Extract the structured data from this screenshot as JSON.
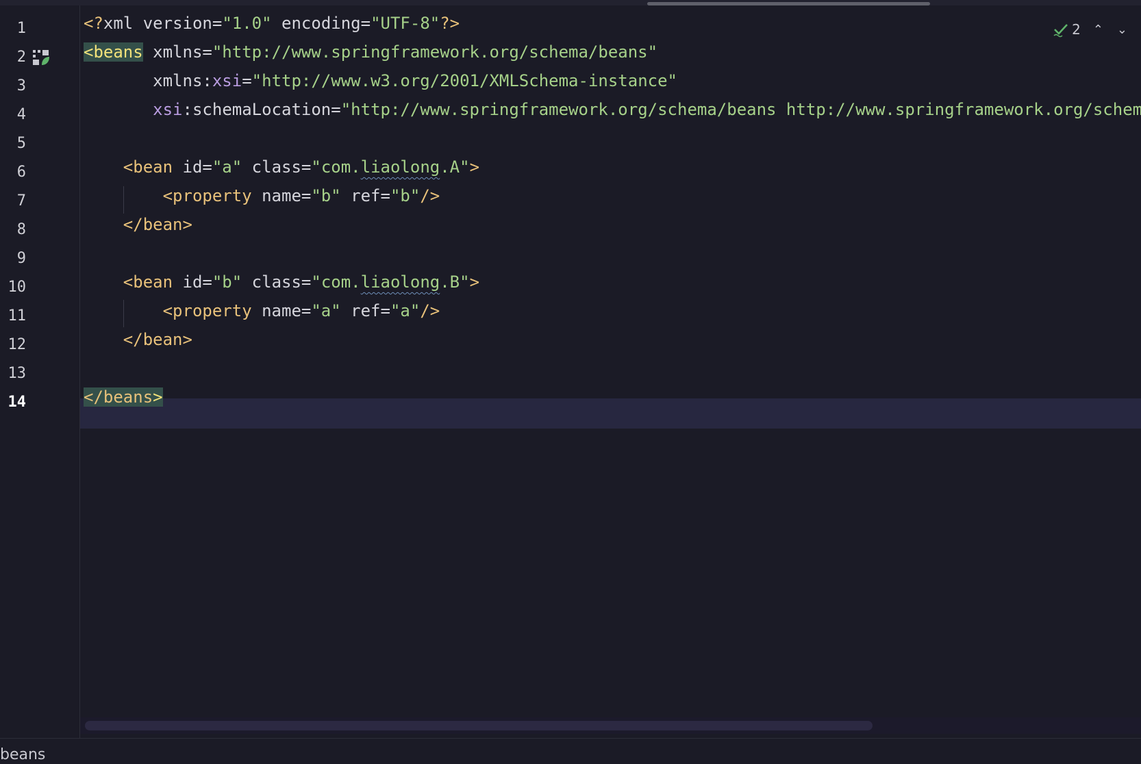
{
  "editor": {
    "language": "xml",
    "current_line": 14,
    "line_numbers": [
      "1",
      "2",
      "3",
      "4",
      "5",
      "6",
      "7",
      "8",
      "9",
      "10",
      "11",
      "12",
      "13",
      "14"
    ],
    "lines": {
      "l1": {
        "pi_open": "<?",
        "pi_name": "xml",
        "sp1": " ",
        "a1": "version",
        "eq1": "=",
        "v1": "\"1.0\"",
        "sp2": " ",
        "a2": "encoding",
        "eq2": "=",
        "v2": "\"UTF-8\"",
        "pi_close": "?>"
      },
      "l2": {
        "tag_open": "<beans",
        "sp": " ",
        "attr": "xmlns",
        "eq": "=",
        "val": "\"http://www.springframework.org/schema/beans\""
      },
      "l3": {
        "indent": "       ",
        "attr": "xmlns:",
        "ns": "xsi",
        "eq": "=",
        "val": "\"http://www.w3.org/2001/XMLSchema-instance\""
      },
      "l4": {
        "indent": "       ",
        "ns": "xsi",
        "attr": ":schemaLocation",
        "eq": "=",
        "val": "\"http://www.springframework.org/schema/beans http://www.springframework.org/schema/beans/spring-beans.xsd\""
      },
      "l6": {
        "indent": "    ",
        "tag": "<bean",
        "sp1": " ",
        "a1": "id",
        "eq1": "=",
        "v1": "\"a\"",
        "sp2": " ",
        "a2": "class",
        "eq2": "=",
        "v2a": "\"com.",
        "v2b": "liaolong",
        "v2c": ".A\"",
        "close": ">"
      },
      "l7": {
        "indent": "        ",
        "tag": "<property",
        "sp1": " ",
        "a1": "name",
        "eq1": "=",
        "v1": "\"b\"",
        "sp2": " ",
        "a2": "ref",
        "eq2": "=",
        "v2": "\"b\"",
        "close": "/>"
      },
      "l8": {
        "indent": "    ",
        "tag": "</bean>"
      },
      "l10": {
        "indent": "    ",
        "tag": "<bean",
        "sp1": " ",
        "a1": "id",
        "eq1": "=",
        "v1": "\"b\"",
        "sp2": " ",
        "a2": "class",
        "eq2": "=",
        "v2a": "\"com.",
        "v2b": "liaolong",
        "v2c": ".B\"",
        "close": ">"
      },
      "l11": {
        "indent": "        ",
        "tag": "<property",
        "sp1": " ",
        "a1": "name",
        "eq1": "=",
        "v1": "\"a\"",
        "sp2": " ",
        "a2": "ref",
        "eq2": "=",
        "v2": "\"a\"",
        "close": "/>"
      },
      "l12": {
        "indent": "    ",
        "tag": "</bean>"
      },
      "l14": {
        "tag": "</beans",
        "close": ">"
      }
    }
  },
  "inspection": {
    "icon": "check-icon",
    "count": "2",
    "up_icon": "chevron-up-icon",
    "down_icon": "chevron-down-icon"
  },
  "status": {
    "breadcrumb": "beans"
  },
  "colors": {
    "background": "#1b1b26",
    "current_line": "#272740",
    "tag": "#e8c17a",
    "value": "#a6d189",
    "namespace": "#b99ce0",
    "match_highlight": "#34504a"
  }
}
